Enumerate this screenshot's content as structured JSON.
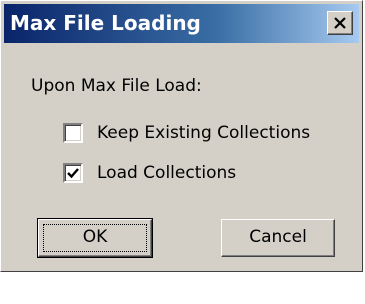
{
  "dialog": {
    "title": "Max File Loading",
    "close_icon": "close-x-icon",
    "prompt": "Upon Max File Load:",
    "options": [
      {
        "label": "Keep Existing Collections",
        "checked": false
      },
      {
        "label": "Load Collections",
        "checked": true
      }
    ],
    "buttons": {
      "ok_label": "OK",
      "cancel_label": "Cancel"
    }
  },
  "colors": {
    "title_start": "#0a246a",
    "title_end": "#a6caf0",
    "face": "#d4d0c8"
  }
}
